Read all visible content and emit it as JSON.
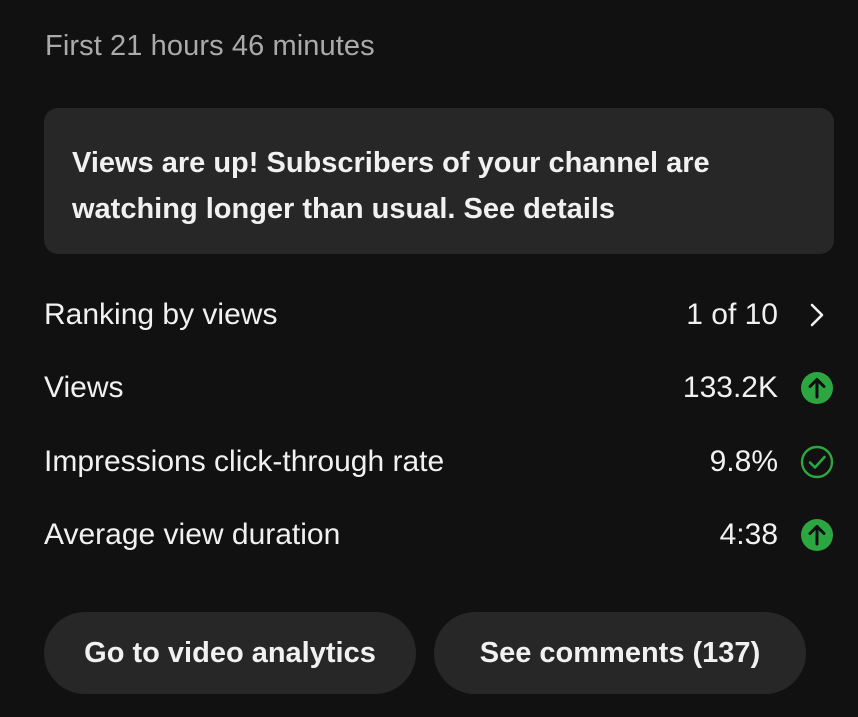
{
  "period": "First 21 hours 46 minutes",
  "banner": {
    "text": "Views are up! Subscribers of your channel are watching longer than usual. See details"
  },
  "metrics": [
    {
      "label": "Ranking by views",
      "value": "1 of 10",
      "icon": "chevron-right-icon"
    },
    {
      "label": "Views",
      "value": "133.2K",
      "icon": "arrow-up-circle-icon"
    },
    {
      "label": "Impressions click-through rate",
      "value": "9.8%",
      "icon": "check-circle-icon"
    },
    {
      "label": "Average view duration",
      "value": "4:38",
      "icon": "arrow-up-circle-icon"
    }
  ],
  "buttons": {
    "analytics": "Go to video analytics",
    "comments": "See comments (137)"
  },
  "colors": {
    "background": "#111111",
    "surface": "#272727",
    "text_primary": "#f1f1f1",
    "text_secondary": "#aaaaaa",
    "positive": "#2ba640"
  }
}
